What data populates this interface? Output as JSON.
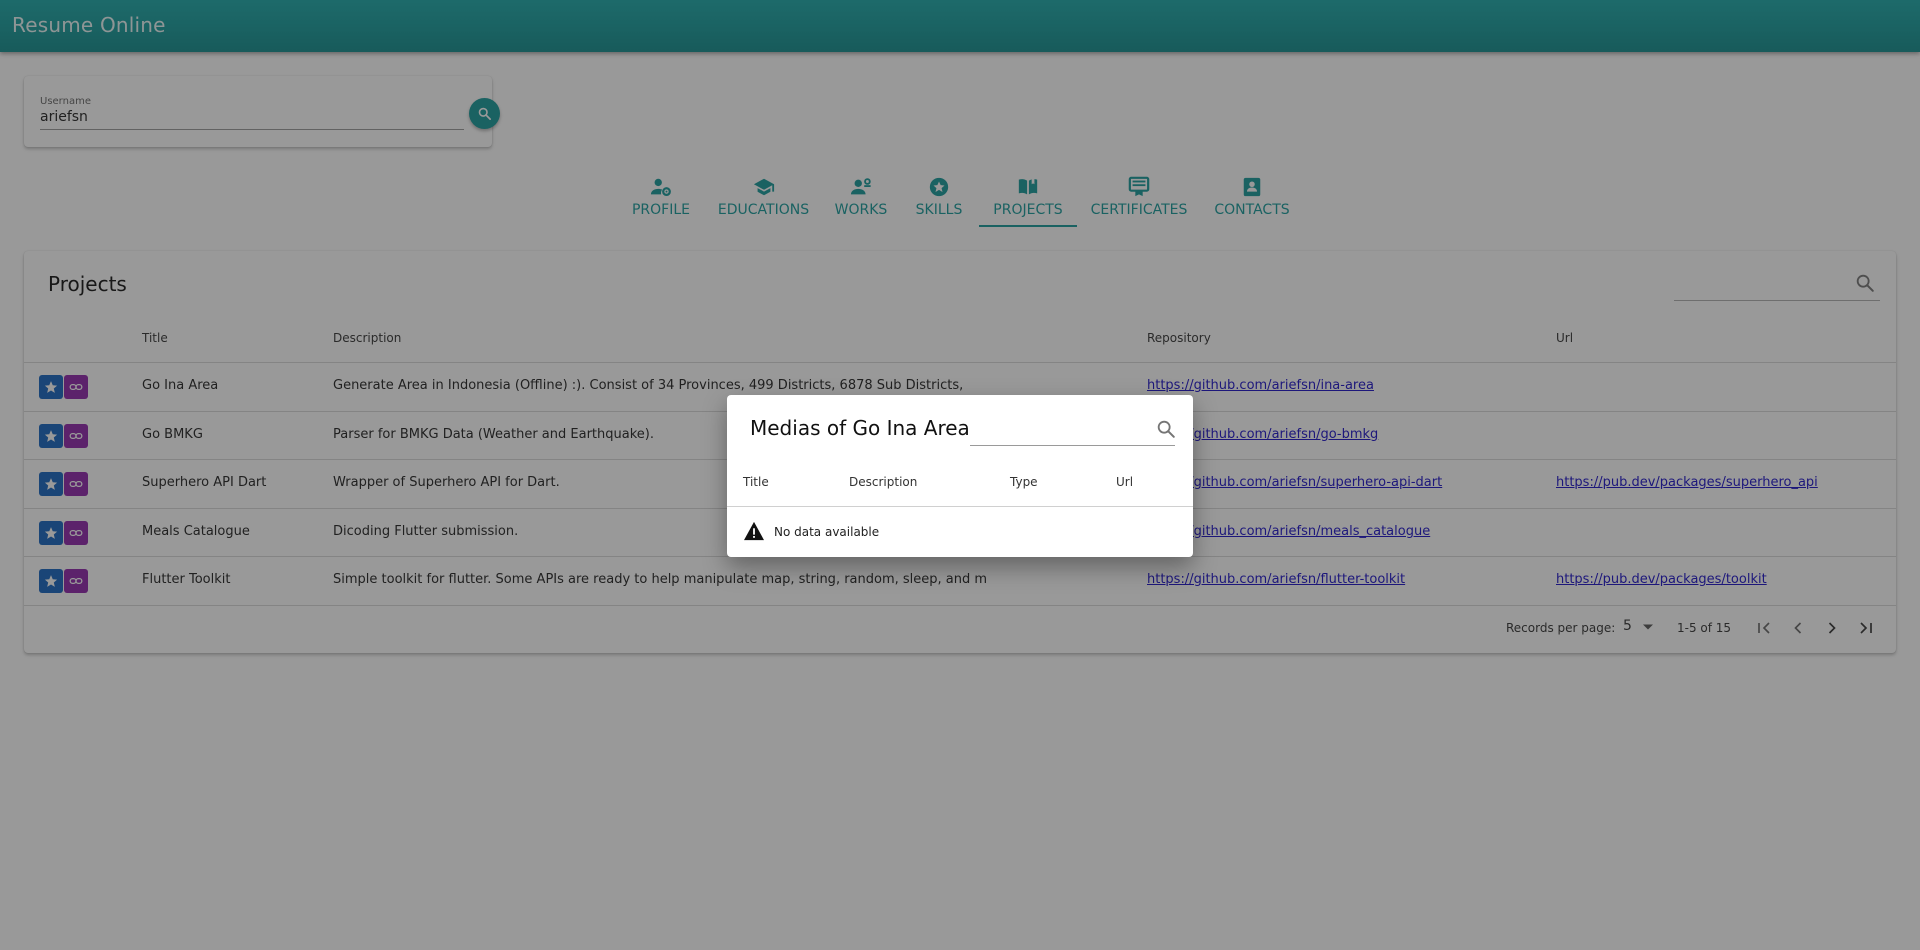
{
  "app": {
    "title": "Resume Online"
  },
  "user_search": {
    "label": "Username",
    "value": "ariefsn"
  },
  "tabs": [
    {
      "label": "PROFILE",
      "icon": "user-gear-icon"
    },
    {
      "label": "EDUCATIONS",
      "icon": "graduation-cap-icon"
    },
    {
      "label": "WORKS",
      "icon": "users-cog-icon"
    },
    {
      "label": "SKILLS",
      "icon": "star-circle-icon"
    },
    {
      "label": "PROJECTS",
      "icon": "book-open-icon",
      "active": true
    },
    {
      "label": "CERTIFICATES",
      "icon": "certificate-icon"
    },
    {
      "label": "CONTACTS",
      "icon": "contact-book-icon"
    }
  ],
  "projects": {
    "title": "Projects",
    "columns": [
      "Title",
      "Description",
      "Repository",
      "Url"
    ],
    "rows": [
      {
        "title": "Go Ina Area",
        "description": "Generate Area in Indonesia (Offline) :). Consist of 34 Provinces, 499 Districts, 6878 Sub Districts,",
        "repository": "https://github.com/ariefsn/ina-area",
        "url": ""
      },
      {
        "title": "Go BMKG",
        "description": "Parser for BMKG Data (Weather and Earthquake).",
        "repository": "https://github.com/ariefsn/go-bmkg",
        "url": ""
      },
      {
        "title": "Superhero API Dart",
        "description": "Wrapper of Superhero API for Dart.",
        "repository": "https://github.com/ariefsn/superhero-api-dart",
        "url": "https://pub.dev/packages/superhero_api"
      },
      {
        "title": "Meals Catalogue",
        "description": "Dicoding Flutter submission.",
        "repository": "https://github.com/ariefsn/meals_catalogue",
        "url": ""
      },
      {
        "title": "Flutter Toolkit",
        "description": "Simple toolkit for flutter. Some APIs are ready to help manipulate map, string, random, sleep, and m",
        "repository": "https://github.com/ariefsn/flutter-toolkit",
        "url": "https://pub.dev/packages/toolkit"
      }
    ],
    "footer": {
      "records_label": "Records per page:",
      "per_page": "5",
      "range": "1-5 of 15"
    }
  },
  "dialog": {
    "title": "Medias of Go Ina Area",
    "columns": [
      "Title",
      "Description",
      "Type",
      "Url"
    ],
    "empty_text": "No data available"
  },
  "colors": {
    "primary": "#159a9a",
    "star_action": "#1565c0",
    "link_action": "#8e24aa",
    "link_text": "#1a10c8"
  }
}
